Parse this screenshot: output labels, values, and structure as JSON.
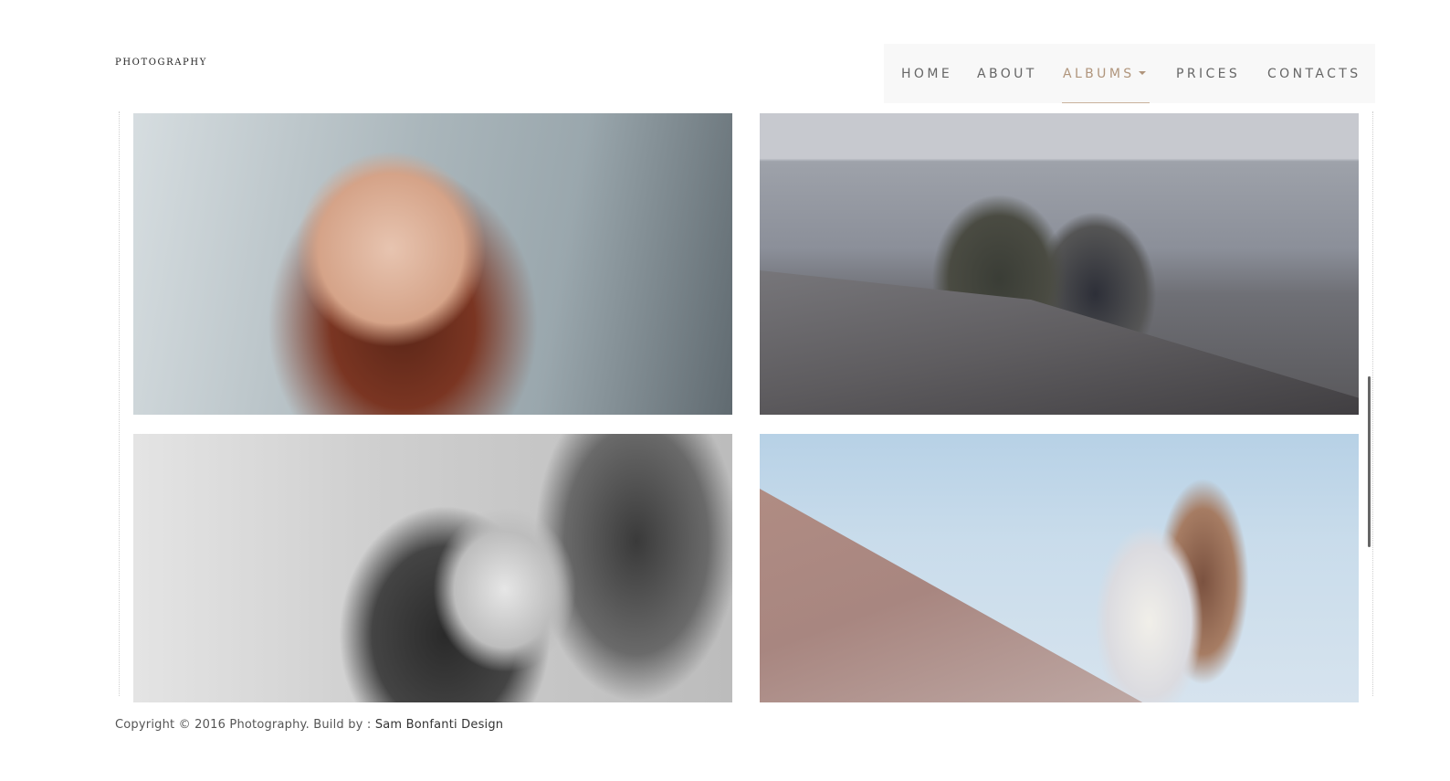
{
  "header": {
    "logo": "PHOTOGRAPHY"
  },
  "nav": {
    "items": [
      {
        "label": "HOME"
      },
      {
        "label": "ABOUT"
      },
      {
        "label": "ALBUMS"
      },
      {
        "label": "PRICES"
      },
      {
        "label": "CONTACTS"
      }
    ],
    "active": "ALBUMS",
    "active_color": "#b0957c"
  },
  "gallery": {
    "photos": [
      {
        "name": "photo-woman-windblown-hair"
      },
      {
        "name": "photo-couple-lakeside"
      },
      {
        "name": "photo-couple-bw-closeup"
      },
      {
        "name": "photo-couple-embrace-sky"
      }
    ]
  },
  "footer": {
    "copyright": "Copyright © 2016 Photography. Build by :",
    "author": "Sam Bonfanti Design"
  }
}
